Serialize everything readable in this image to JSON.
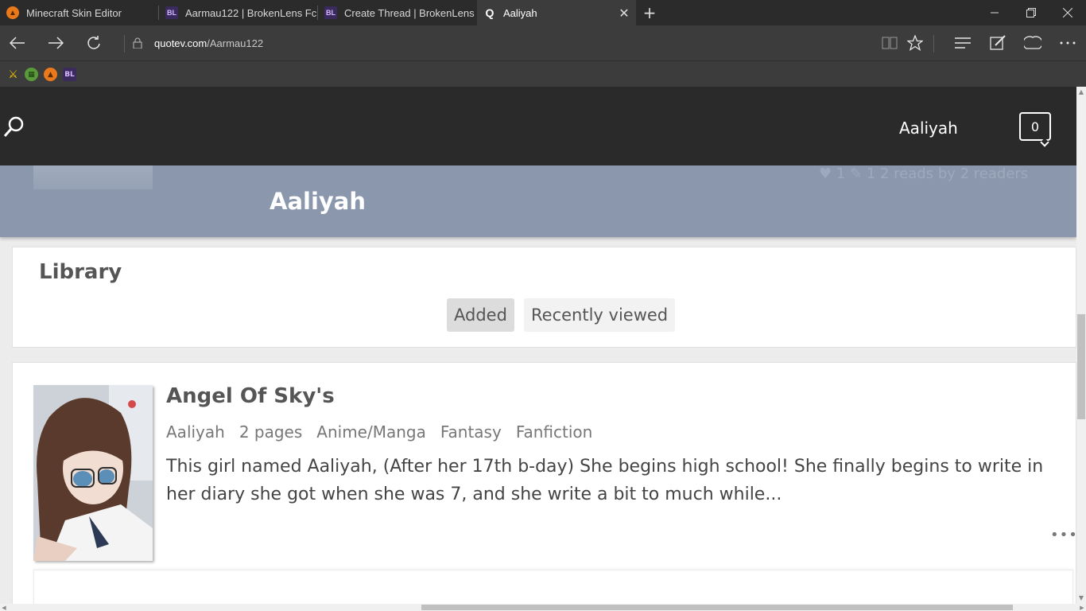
{
  "browser": {
    "tabs": [
      {
        "title": "Minecraft Skin Editor",
        "icon": "pumpkin-icon",
        "active": false
      },
      {
        "title": "Aarmau122 | BrokenLens Fc",
        "icon": "brokenlens-icon",
        "active": false
      },
      {
        "title": "Create Thread | BrokenLens",
        "icon": "brokenlens-icon",
        "active": false
      },
      {
        "title": "Aaliyah",
        "icon": "quotev-icon",
        "active": true
      }
    ],
    "address": {
      "host": "quotev.com",
      "path": "/Aarmau122"
    },
    "favorites": [
      "sword-icon",
      "creeper-icon",
      "pumpkin-icon",
      "brokenlens-icon"
    ]
  },
  "site": {
    "header": {
      "username": "Aaliyah",
      "notification_count": "0"
    },
    "profile": {
      "name": "Aaliyah",
      "faded_stats": "♥ 1   ✎ 1   2 reads by 2 readers"
    },
    "library": {
      "title": "Library",
      "filters": [
        {
          "label": "Added",
          "selected": true
        },
        {
          "label": "Recently viewed",
          "selected": false
        }
      ]
    },
    "story": {
      "title": "Angel Of Sky's",
      "author": "Aaliyah",
      "pages": "2 pages",
      "tags": [
        "Anime/Manga",
        "Fantasy",
        "Fanfiction"
      ],
      "description": "This girl named Aaliyah, (After her 17th b-day) She begins high school! She finally begins to write in her diary she got when she was 7, and she write a bit to much while...",
      "more": "•••"
    }
  },
  "colors": {
    "chrome_dark": "#2b2b2b",
    "chrome_bar": "#3c3c3c",
    "site_header": "#2a2a2a",
    "profile_band": "#8a97ad",
    "page_bg": "#ececec"
  }
}
